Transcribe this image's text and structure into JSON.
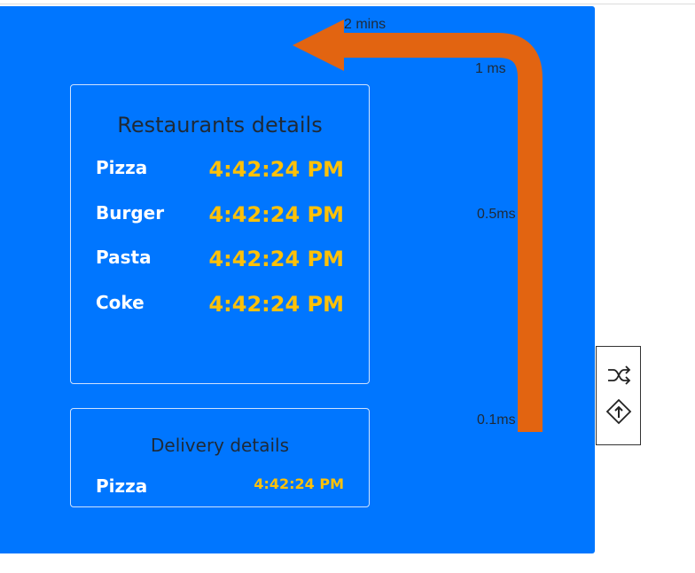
{
  "restaurants": {
    "title": "Restaurants details",
    "rows": [
      {
        "name": "Pizza",
        "time": "4:42:24 PM"
      },
      {
        "name": "Burger",
        "time": "4:42:24 PM"
      },
      {
        "name": "Pasta",
        "time": "4:42:24 PM"
      },
      {
        "name": "Coke",
        "time": "4:42:24 PM"
      }
    ]
  },
  "delivery": {
    "title": "Delivery details",
    "rows": [
      {
        "name": "Pizza",
        "time": "4:42:24 PM"
      }
    ]
  },
  "timeline": {
    "labels": [
      "2 mins",
      "1 ms",
      "0.5ms",
      "0.1ms"
    ]
  },
  "toolbox": {
    "icons": [
      "shuffle-icon",
      "turn-direction-icon"
    ]
  },
  "colors": {
    "panel": "#0076ff",
    "arrow": "#e26411",
    "time_text": "#ffc107",
    "title_text": "#1f2a37"
  }
}
